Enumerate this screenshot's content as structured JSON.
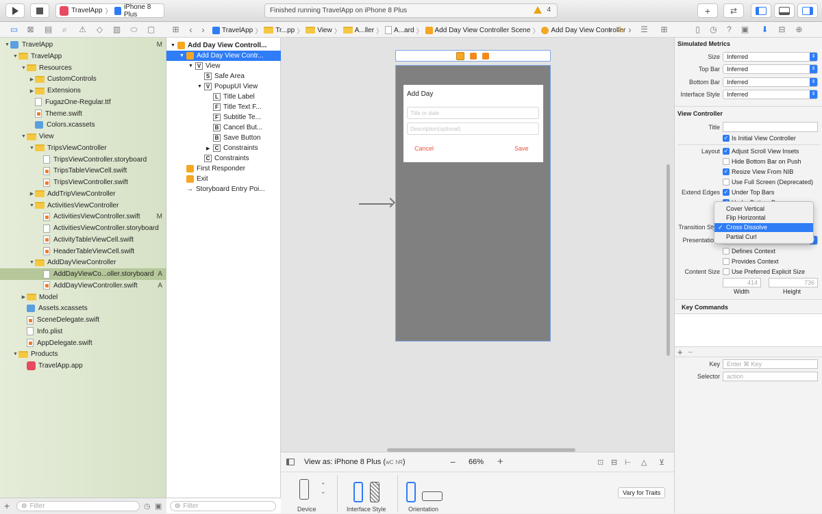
{
  "toolbar": {
    "scheme": "TravelApp",
    "device": "iPhone 8 Plus",
    "status": "Finished running TravelApp on iPhone 8 Plus",
    "warnings": "4"
  },
  "jumpbar": [
    "TravelApp",
    "Tr...pp",
    "View",
    "A...ller",
    "A...ard",
    "Add Day View Controller Scene",
    "Add Day View Controller"
  ],
  "navigator": {
    "items": [
      {
        "label": "TravelApp",
        "level": 0,
        "kind": "project",
        "open": true,
        "flag": "M"
      },
      {
        "label": "TravelApp",
        "level": 1,
        "kind": "folder",
        "open": true
      },
      {
        "label": "Resources",
        "level": 2,
        "kind": "folder",
        "open": true
      },
      {
        "label": "CustomControls",
        "level": 3,
        "kind": "folder",
        "open": false
      },
      {
        "label": "Extensions",
        "level": 3,
        "kind": "folder",
        "open": false
      },
      {
        "label": "FugazOne-Regular.ttf",
        "level": 3,
        "kind": "plist"
      },
      {
        "label": "Theme.swift",
        "level": 3,
        "kind": "swift"
      },
      {
        "label": "Colors.xcassets",
        "level": 3,
        "kind": "asset"
      },
      {
        "label": "View",
        "level": 2,
        "kind": "folder",
        "open": true
      },
      {
        "label": "TripsViewController",
        "level": 3,
        "kind": "folder",
        "open": true
      },
      {
        "label": "TripsViewController.storyboard",
        "level": 4,
        "kind": "storyboard"
      },
      {
        "label": "TripsTableViewCell.swift",
        "level": 4,
        "kind": "swift"
      },
      {
        "label": "TripsViewController.swift",
        "level": 4,
        "kind": "swift"
      },
      {
        "label": "AddTripViewController",
        "level": 3,
        "kind": "folder",
        "open": false
      },
      {
        "label": "ActivitiesViewController",
        "level": 3,
        "kind": "folder",
        "open": true
      },
      {
        "label": "ActivitiesViewController.swift",
        "level": 4,
        "kind": "swift",
        "flag": "M"
      },
      {
        "label": "ActivitiesViewController.storyboard",
        "level": 4,
        "kind": "storyboard"
      },
      {
        "label": "ActivityTableViewCell.swift",
        "level": 4,
        "kind": "swift"
      },
      {
        "label": "HeaderTableViewCell.swift",
        "level": 4,
        "kind": "swift"
      },
      {
        "label": "AddDayViewController",
        "level": 3,
        "kind": "folder",
        "open": true
      },
      {
        "label": "AddDayViewCo...oller.storyboard",
        "level": 4,
        "kind": "storyboard",
        "flag": "A",
        "selected": true
      },
      {
        "label": "AddDayViewController.swift",
        "level": 4,
        "kind": "swift",
        "flag": "A"
      },
      {
        "label": "Model",
        "level": 2,
        "kind": "folder",
        "open": false
      },
      {
        "label": "Assets.xcassets",
        "level": 2,
        "kind": "asset"
      },
      {
        "label": "SceneDelegate.swift",
        "level": 2,
        "kind": "swift"
      },
      {
        "label": "Info.plist",
        "level": 2,
        "kind": "plist"
      },
      {
        "label": "AppDelegate.swift",
        "level": 2,
        "kind": "swift"
      },
      {
        "label": "Products",
        "level": 1,
        "kind": "folder",
        "open": true
      },
      {
        "label": "TravelApp.app",
        "level": 2,
        "kind": "app"
      }
    ],
    "filter_placeholder": "Filter"
  },
  "outline": {
    "items": [
      {
        "label": "Add Day View Controll...",
        "level": 0,
        "icon": "Y",
        "bold": true
      },
      {
        "label": "Add Day View Contr...",
        "level": 1,
        "icon": "Y",
        "selected": true
      },
      {
        "label": "View",
        "level": 2,
        "icon": "V"
      },
      {
        "label": "Safe Area",
        "level": 3,
        "icon": "S"
      },
      {
        "label": "PopupUI View",
        "level": 3,
        "icon": "V"
      },
      {
        "label": "Title Label",
        "level": 4,
        "icon": "L"
      },
      {
        "label": "Title Text F...",
        "level": 4,
        "icon": "F"
      },
      {
        "label": "Subtitle Te...",
        "level": 4,
        "icon": "F"
      },
      {
        "label": "Cancel But...",
        "level": 4,
        "icon": "B"
      },
      {
        "label": "Save Button",
        "level": 4,
        "icon": "B"
      },
      {
        "label": "Constraints",
        "level": 4,
        "icon": "C"
      },
      {
        "label": "Constraints",
        "level": 3,
        "icon": "C"
      },
      {
        "label": "First Responder",
        "level": 1,
        "icon": "R"
      },
      {
        "label": "Exit",
        "level": 1,
        "icon": "E"
      },
      {
        "label": "Storyboard Entry Poi...",
        "level": 1,
        "icon": "→"
      }
    ],
    "filter_placeholder": "Filter"
  },
  "popup": {
    "title": "Add Day",
    "title_placeholder": "Title or date",
    "desc_placeholder": "Description(optional)",
    "cancel": "Cancel",
    "save": "Save"
  },
  "canvas_bottom": {
    "view_as": "View as: iPhone 8 Plus (",
    "wc": "wC",
    "hr": "hR",
    "view_as_end": ")",
    "zoom": "66%",
    "device_label": "Device",
    "interface_style_label": "Interface Style",
    "orientation_label": "Orientation",
    "vary_button": "Vary for Traits"
  },
  "inspector": {
    "simulated_metrics": "Simulated Metrics",
    "size_label": "Size",
    "size_value": "Inferred",
    "top_bar_label": "Top Bar",
    "top_bar_value": "Inferred",
    "bottom_bar_label": "Bottom Bar",
    "bottom_bar_value": "Inferred",
    "interface_style_label": "Interface Style",
    "interface_style_value": "Inferred",
    "view_controller": "View Controller",
    "title_label": "Title",
    "is_initial": "Is Initial View Controller",
    "layout_label": "Layout",
    "adjust_insets": "Adjust Scroll View Insets",
    "hide_bottom": "Hide Bottom Bar on Push",
    "resize_nib": "Resize View From NIB",
    "full_screen": "Use Full Screen (Deprecated)",
    "extend_edges_label": "Extend Edges",
    "under_top": "Under Top Bars",
    "under_bottom": "Under Bottom Bars",
    "transition_label": "Transition Sty",
    "presentation_label": "Presentation",
    "defines_context": "Defines Context",
    "provides_context": "Provides Context",
    "content_size_label": "Content Size",
    "use_preferred": "Use Preferred Explicit Size",
    "width_value": "414",
    "height_value": "736",
    "width_label": "Width",
    "height_label": "Height",
    "key_commands": "Key Commands",
    "key_label": "Key",
    "key_placeholder": "Enter ⌘ Key",
    "selector_label": "Selector",
    "selector_placeholder": "action"
  },
  "transition_menu": {
    "options": [
      "Cover Vertical",
      "Flip Horizontal",
      "Cross Dissolve",
      "Partial Curl"
    ],
    "selected": "Cross Dissolve"
  },
  "colors": {
    "accent": "#2e7cf6",
    "popup_button": "#e8523a",
    "sim_view": "#808080"
  }
}
